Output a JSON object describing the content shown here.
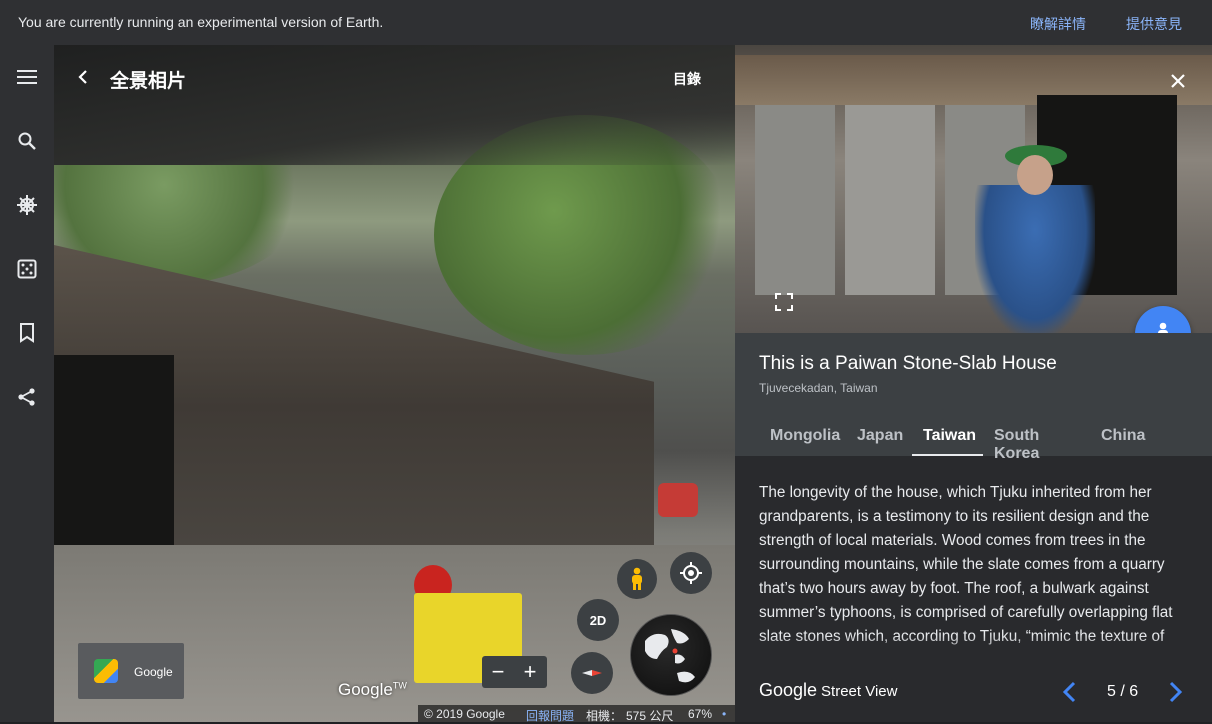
{
  "banner": {
    "message": "You are currently running an experimental version of Earth.",
    "learn_more": "瞭解詳情",
    "feedback": "提供意見"
  },
  "rail": {
    "icons": [
      "menu-icon",
      "search-icon",
      "voyager-icon",
      "feeling-lucky-icon",
      "projects-icon",
      "share-icon"
    ]
  },
  "viewer": {
    "title": "全景相片",
    "toc": "目錄",
    "maps_card_label": "Google",
    "watermark": "Google",
    "watermark_tm": "TW",
    "mode_2d": "2D",
    "zoom_out": "−",
    "zoom_in": "+",
    "footer": {
      "copyright": "© 2019 Google",
      "report": "回報問題",
      "camera": "相機：",
      "altitude": "575 公尺",
      "percent": "67%"
    }
  },
  "panel": {
    "title": "This is a Paiwan Stone-Slab House",
    "subtitle": "Tjuvecekadan, Taiwan",
    "tabs": [
      "Mongolia",
      "Japan",
      "Taiwan",
      "South Korea",
      "China"
    ],
    "active_tab": "Taiwan",
    "body": "The longevity of the house, which Tjuku inherited from her grandparents, is a testimony to its resilient design and the strength of local materials. Wood comes from trees in the surrounding mountains, while the slate comes from a quarry that’s two hours away by foot. The roof, a bulwark against summer’s typhoons, is comprised of carefully overlapping flat slate stones which, according to Tjuku, “mimic the texture of",
    "brand_google": "Google",
    "brand_sv": "Street View",
    "page": "5 / 6"
  },
  "colors": {
    "accent": "#8ab4f8",
    "fab": "#4285f4",
    "panel_bg": "#292a2d",
    "rail_bg": "#2f3033"
  }
}
